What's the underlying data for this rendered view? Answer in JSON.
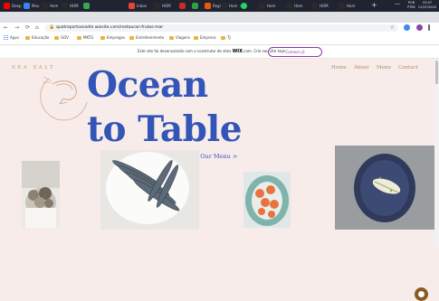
{
  "taskbar": {
    "tabs": [
      {
        "label": "Deep",
        "color": "#ff0000"
      },
      {
        "label": "Meu",
        "color": "#3b82f6"
      },
      {
        "label": "Hom",
        "color": "#2a2a2a"
      },
      {
        "label": "HOM",
        "color": "#2a2a2a"
      },
      {
        "label": "",
        "color": "#34a853"
      },
      {
        "label": "Inbox",
        "color": "#ea4335"
      },
      {
        "label": "HOM",
        "color": "#2a2a2a"
      },
      {
        "label": "",
        "color": "#c92a2a"
      },
      {
        "label": "",
        "color": "#2f9e44"
      },
      {
        "label": "Regio",
        "color": "#e8590c"
      },
      {
        "label": "Hom",
        "color": "#2a2a2a"
      },
      {
        "label": "",
        "color": "#25d366"
      },
      {
        "label": "Hom",
        "color": "#2a2a2a"
      },
      {
        "label": "Hom",
        "color": "#2a2a2a"
      },
      {
        "label": "HOM",
        "color": "#2a2a2a"
      },
      {
        "label": "Hom",
        "color": "#2a2a2a"
      }
    ],
    "new_tab": "+",
    "minimize": "—",
    "lang_1": "POR",
    "lang_2": "PTB2",
    "time": "23:07",
    "date": "11/07/2020"
  },
  "browser": {
    "url": "quatroportossadm.wixsite.com/restauran-frutos-mar",
    "back": "←",
    "forward": "→",
    "reload": "⟳",
    "home": "⌂",
    "star": "☆"
  },
  "bookmarks": [
    "Apps",
    "Educação",
    "GOV",
    "MKTG",
    "Empregos",
    "Entretenimento",
    "Viagens",
    "Empresa",
    "TJ"
  ],
  "wix_banner": {
    "text_before": "Este site foi desenvolvido com o construtor de sites",
    "brand": "WIX",
    "text_after": ".com. Crie seu site hoje.",
    "button": "Comece já"
  },
  "site": {
    "brand": "SEA SALT",
    "menu": [
      "Home",
      "About",
      "Menu",
      "Contact"
    ],
    "headline_line1": "Ocean",
    "headline_line2": "to Table",
    "cta": "See Our Menu >"
  },
  "colors": {
    "accent_blue": "#3455b8",
    "nav_gold": "#b08a66",
    "background": "#f8ecea",
    "wix_purple": "#8b3aa8"
  }
}
